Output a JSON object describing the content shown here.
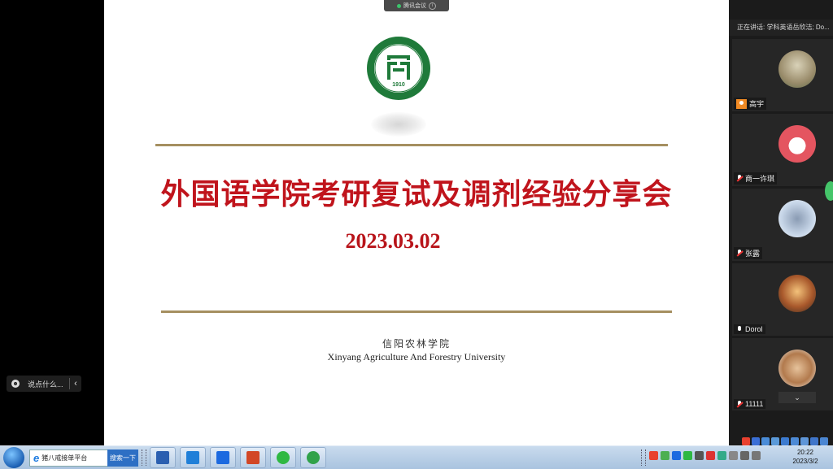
{
  "meeting_bar": {
    "label": "腾讯会议"
  },
  "slide": {
    "title": "外国语学院考研复试及调剂经验分享会",
    "date": "2023.03.02",
    "university_cn": "信阳农林学院",
    "university_en": "Xinyang Agriculture And Forestry University",
    "logo_year": "1910",
    "logo_ring_text": "XINYANG AGRICULTURE AND FORESTRY UNIVERSITY"
  },
  "chat": {
    "placeholder": "说点什么...",
    "collapse": "‹"
  },
  "participants_panel": {
    "speaking": "正在讲话: 学科英语岳欣洁; Do...",
    "participants": [
      {
        "name": "高宇",
        "status": "host"
      },
      {
        "name": "商一许琪",
        "status": "muted"
      },
      {
        "name": "张露",
        "status": "muted"
      },
      {
        "name": "Dorol",
        "status": "unmuted"
      },
      {
        "name": "11111",
        "status": "muted"
      }
    ],
    "scroll_down": "⌄"
  },
  "taskbar": {
    "search_placeholder": "猪八戒接单平台",
    "search_button": "搜索一下",
    "time": "20:22",
    "date": "2023/3/2"
  },
  "colors": {
    "title_red": "#c0141c",
    "rule_gold": "#a58f60",
    "logo_green": "#1f7a3a"
  }
}
